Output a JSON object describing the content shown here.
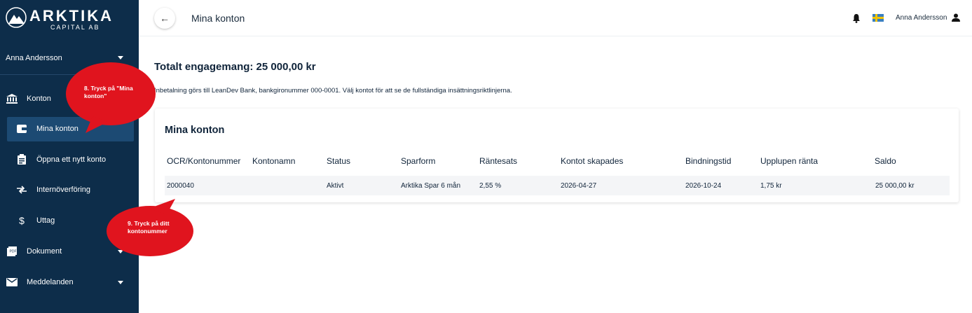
{
  "brand": {
    "name": "ARKTIKA",
    "sub": "CAPITAL AB"
  },
  "sidebar": {
    "user": "Anna Andersson",
    "items": [
      {
        "label": "Konton",
        "icon": "bank-icon"
      },
      {
        "label": "Mina konton",
        "icon": "wallet-icon"
      },
      {
        "label": "Öppna ett nytt konto",
        "icon": "clipboard-icon"
      },
      {
        "label": "Internöverföring",
        "icon": "transfer-icon"
      },
      {
        "label": "Uttag",
        "icon": "dollar-icon"
      },
      {
        "label": "Dokument",
        "icon": "pdf-icon"
      },
      {
        "label": "Meddelanden",
        "icon": "mail-icon"
      }
    ]
  },
  "header": {
    "title": "Mina konton",
    "user": "Anna Andersson"
  },
  "main": {
    "total": "Totalt engagemang: 25 000,00 kr",
    "info": "Inbetalning görs till LeanDev Bank, bankgironummer 000-0001. Välj kontot för att se de fullständiga insättningsriktlinjerna.",
    "card_title": "Mina konton",
    "columns": [
      "OCR/Kontonummer",
      "Kontonamn",
      "Status",
      "Sparform",
      "Räntesats",
      "Kontot skapades",
      "Bindningstid",
      "Upplupen ränta",
      "Saldo"
    ],
    "rows": [
      [
        "2000040",
        "",
        "Aktivt",
        "Arktika Spar 6 mån",
        "2,55 %",
        "2026-04-27",
        "2026-10-24",
        "1,75 kr",
        "25 000,00 kr"
      ]
    ]
  },
  "callouts": [
    {
      "text": "8. Tryck på \"Mina konton\""
    },
    {
      "text": "9. Tryck på ditt kontonummer"
    }
  ],
  "colors": {
    "sidebar": "#0d2d4a",
    "active": "#1c4a73",
    "callout": "#e0141e"
  }
}
